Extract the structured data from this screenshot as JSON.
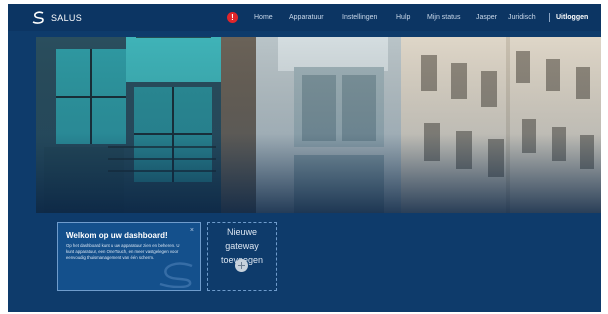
{
  "app": {
    "brand": "SALUS"
  },
  "nav": {
    "alert_badge": "!",
    "items": [
      {
        "label": "Home"
      },
      {
        "label": "Apparatuur"
      },
      {
        "label": "Instellingen"
      },
      {
        "label": "Hulp"
      },
      {
        "label": "Mijn status"
      },
      {
        "label": "Jasper"
      },
      {
        "label": "Juridisch"
      }
    ],
    "logout_label": "Uitloggen"
  },
  "welcome_card": {
    "title": "Welkom op uw dashboard!",
    "body": "Op het dashboard kunt u uw apparatuur zien en beheren. U kunt apparatuur, een OneTouch, en meer vastgelegen voor eenvoudig thuismanagement van één scherm.",
    "close_symbol": "×"
  },
  "gateway_card": {
    "line1": "Nieuwe",
    "line2": "gateway",
    "line3": "toevoegen"
  },
  "colors": {
    "background": "#0e3b6b",
    "topbar": "#0c3563",
    "card": "#14508c",
    "alert": "#e0262b"
  }
}
